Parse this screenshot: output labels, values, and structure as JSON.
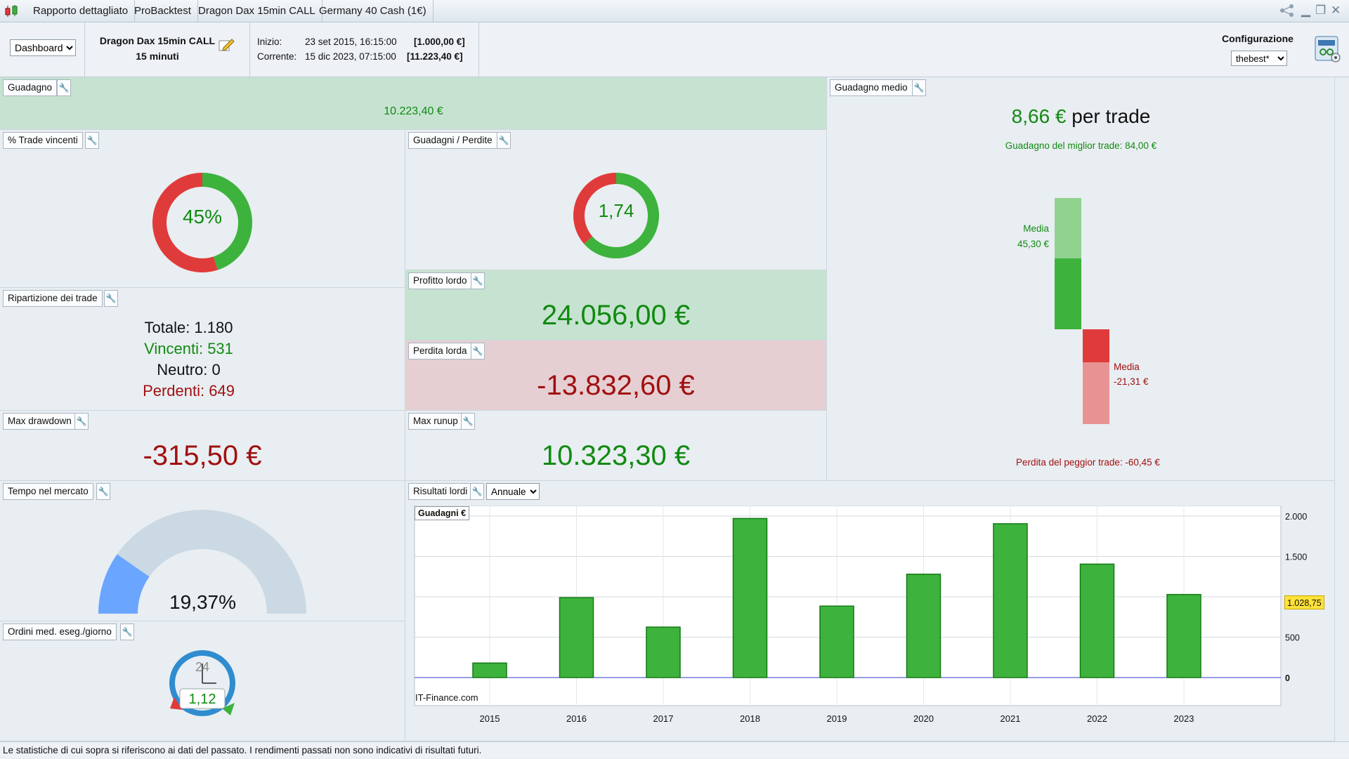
{
  "titlebar": {
    "tabs": [
      "Rapporto dettagliato",
      "ProBacktest",
      "Dragon Dax 15min CALL",
      "Germany 40 Cash (1€)"
    ]
  },
  "header": {
    "view_select": "Dashboard",
    "strategy_name": "Dragon Dax 15min CALL",
    "timeframe": "15 minuti",
    "start_label": "Inizio:",
    "start_date": "23 set 2015, 16:15:00",
    "start_value": "[1.000,00 €]",
    "current_label": "Corrente:",
    "current_date": "15 dic 2023, 07:15:00",
    "current_value": "[11.223,40 €]",
    "config_label": "Configurazione",
    "config_select": "thebest*"
  },
  "gain": {
    "title": "Guadagno",
    "value": "10.223,40 €"
  },
  "win_pct": {
    "title": "% Trade vincenti",
    "label": "45%",
    "value": 45
  },
  "gain_loss": {
    "title": "Guadagni / Perdite",
    "label": "1,74",
    "ratio": 1.74
  },
  "breakdown": {
    "title": "Ripartizione dei trade",
    "total": "Totale: 1.180",
    "winners": "Vincenti: 531",
    "neutral": "Neutro: 0",
    "losers": "Perdenti: 649"
  },
  "gross_profit": {
    "title": "Profitto lordo",
    "value": "24.056,00 €"
  },
  "gross_loss": {
    "title": "Perdita lorda",
    "value": "-13.832,60 €"
  },
  "max_drawdown": {
    "title": "Max drawdown",
    "value": "-315,50 €"
  },
  "max_runup": {
    "title": "Max runup",
    "value": "10.323,30 €"
  },
  "avg_gain": {
    "title": "Guadagno medio",
    "value": "8,66 €",
    "unit": "per trade",
    "best_label": "Guadagno del miglior trade: 84,00 €",
    "avg_win_label": "Media",
    "avg_win_value": "45,30 €",
    "avg_loss_label": "Media",
    "avg_loss_value": "-21,31 €",
    "worst_label": "Perdita del peggior trade: -60,45 €",
    "best": 84.0,
    "avg_win": 45.3,
    "avg_loss": -21.31,
    "worst": -60.45
  },
  "time_in_market": {
    "title": "Tempo nel mercato",
    "label": "19,37%",
    "value": 19.37
  },
  "orders_per_day": {
    "title": "Ordini med. eseg./giorno",
    "value": "1,12",
    "clock_label": "24"
  },
  "results": {
    "title": "Risultati lordi",
    "period_select": "Annuale",
    "legend": "Guadagni €",
    "watermark": "IT-Finance.com",
    "current_label": "1.028,75"
  },
  "chart_data": {
    "type": "bar",
    "categories": [
      "2015",
      "2016",
      "2017",
      "2018",
      "2019",
      "2020",
      "2021",
      "2022",
      "2023"
    ],
    "values": [
      180,
      990,
      625,
      1970,
      885,
      1280,
      1905,
      1405,
      1028.75
    ],
    "y_ticks": [
      "0",
      "500",
      "1.500",
      "2.000"
    ],
    "ylim": [
      0,
      2000
    ],
    "grid": true,
    "bar_color": "#3db33d"
  },
  "footer": {
    "disclaimer": "Le statistiche di cui sopra si riferiscono ai dati del passato. I rendimenti passati non sono indicativi di risultati futuri."
  },
  "colors": {
    "green": "#3db33d",
    "red": "#e03b3b",
    "gain_bg": "#c6e3d1",
    "loss_bg": "#e6cfd3",
    "gauge_fill": "#6aa6ff",
    "gauge_track": "#cad9e3"
  }
}
